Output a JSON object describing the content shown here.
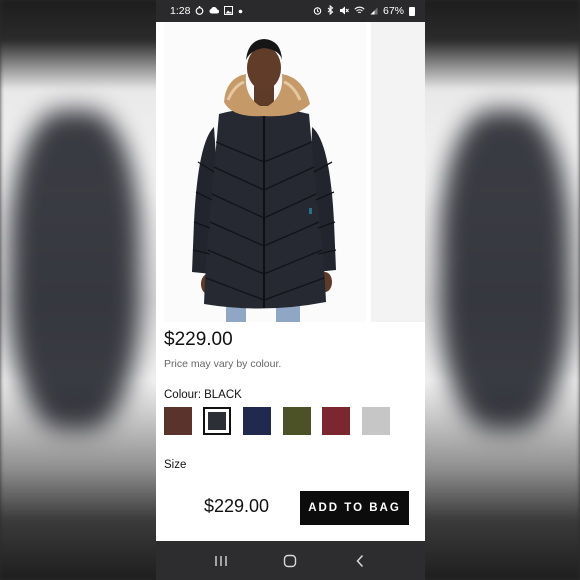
{
  "status_bar": {
    "time": "1:28",
    "battery": "67%",
    "left_icons": [
      "timer-icon",
      "cloud-icon",
      "image-icon",
      "dot-icon"
    ],
    "right_icons": [
      "alarm-icon",
      "bluetooth-icon",
      "mute-icon",
      "wifi-icon",
      "signal-icon",
      "battery-icon"
    ]
  },
  "product": {
    "image_icon": "black-quilted-parka-with-fur-hood",
    "price": "$229.00",
    "price_note": "Price may vary by colour.",
    "colour_label": "Colour:",
    "colour_value": "BLACK",
    "swatches": [
      {
        "name": "brown",
        "color": "#5a332b",
        "selected": false
      },
      {
        "name": "black",
        "color": "#2d2f37",
        "selected": true
      },
      {
        "name": "navy",
        "color": "#1f2a4e",
        "selected": false
      },
      {
        "name": "olive",
        "color": "#4d5126",
        "selected": false
      },
      {
        "name": "burgundy",
        "color": "#7a2730",
        "selected": false
      },
      {
        "name": "light-grey",
        "color": "#c6c6c6",
        "selected": false
      }
    ],
    "size_label": "Size"
  },
  "purchase_bar": {
    "price": "$229.00",
    "add_to_bag": "ADD TO BAG"
  },
  "nav_bar": {
    "icons": [
      "recent-apps-icon",
      "home-icon",
      "back-icon"
    ]
  }
}
